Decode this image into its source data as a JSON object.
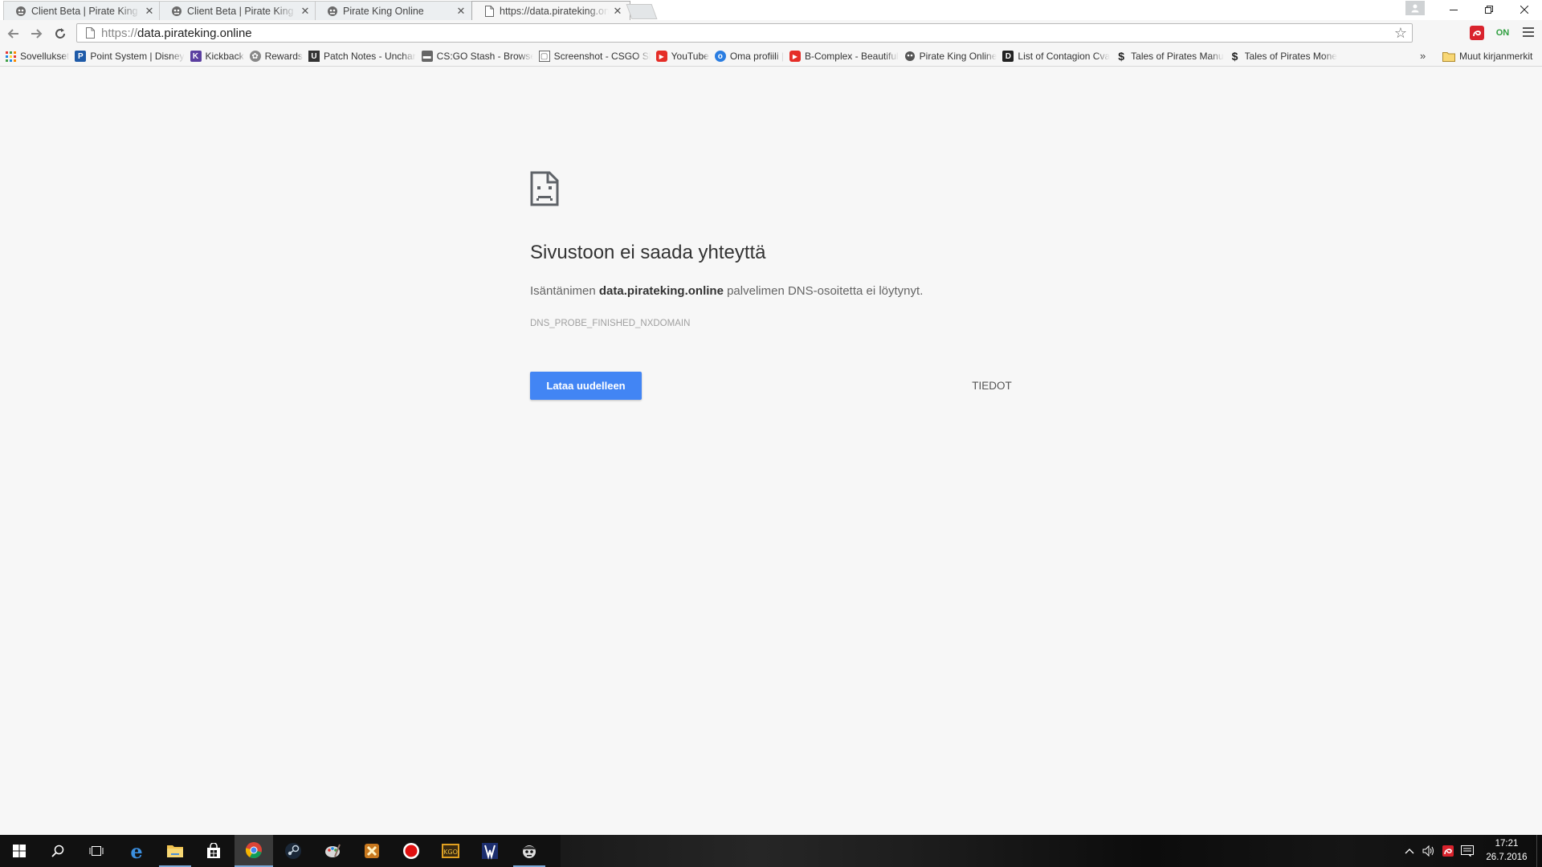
{
  "browser": {
    "tabs": [
      {
        "title": "Client Beta | Pirate King O",
        "icon": "pirate-icon",
        "active": false
      },
      {
        "title": "Client Beta | Pirate King O",
        "icon": "pirate-icon",
        "active": false
      },
      {
        "title": "Pirate King Online",
        "icon": "pirate-icon",
        "active": false
      },
      {
        "title": "https://data.pirateking.on",
        "icon": "page-icon",
        "active": true
      }
    ],
    "close_glyph": "✕",
    "omnibox": {
      "scheme": "https://",
      "host": "data.pirateking.online"
    },
    "bookmarks": [
      {
        "label": "Sovellukset",
        "icon": "apps-grid-icon",
        "color": "#e53935"
      },
      {
        "label": "Point System | Disney",
        "icon": "pd-icon",
        "color": "#1e5aa8"
      },
      {
        "label": "Kickback",
        "icon": "kickback-icon",
        "color": "#5b3fa0"
      },
      {
        "label": "Rewards",
        "icon": "rewards-icon",
        "color": "#777777"
      },
      {
        "label": "Patch Notes - Unchar",
        "icon": "uncharted-icon",
        "color": "#333333"
      },
      {
        "label": "CS:GO Stash - Browse",
        "icon": "csgo-icon",
        "color": "#555555"
      },
      {
        "label": "Screenshot - CSGO Sk",
        "icon": "screenshot-icon",
        "color": "#555555"
      },
      {
        "label": "YouTube",
        "icon": "youtube-icon",
        "color": "#e52d27"
      },
      {
        "label": "Oma profiili |",
        "icon": "profile-icon",
        "color": "#2a7de1"
      },
      {
        "label": "B-Complex - Beautiful",
        "icon": "youtube-icon",
        "color": "#e52d27"
      },
      {
        "label": "Pirate King Online",
        "icon": "pirate-icon",
        "color": "#555555"
      },
      {
        "label": "List of Contagion Cva",
        "icon": "contagion-icon",
        "color": "#222222"
      },
      {
        "label": "Tales of Pirates Manu",
        "icon": "dollar-icon",
        "color": "#222222"
      },
      {
        "label": "Tales of Pirates Mone",
        "icon": "dollar-icon",
        "color": "#222222"
      }
    ],
    "bookmarks_overflow": "»",
    "other_bookmarks": "Muut kirjanmerkit"
  },
  "error_page": {
    "heading": "Sivustoon ei saada yhteyttä",
    "desc_prefix": "Isäntänimen ",
    "desc_host": "data.pirateking.online",
    "desc_suffix": " palvelimen DNS-osoitetta ei löytynyt.",
    "error_code": "DNS_PROBE_FINISHED_NXDOMAIN",
    "reload_label": "Lataa uudelleen",
    "details_label": "TIEDOT",
    "accent_color": "#4285f4"
  },
  "taskbar": {
    "apps": [
      {
        "name": "search-icon"
      },
      {
        "name": "task-view-icon"
      },
      {
        "name": "edge-icon"
      },
      {
        "name": "file-explorer-icon"
      },
      {
        "name": "store-icon"
      },
      {
        "name": "chrome-icon"
      },
      {
        "name": "steam-icon"
      },
      {
        "name": "paint-icon"
      },
      {
        "name": "game-icon"
      },
      {
        "name": "record-icon"
      },
      {
        "name": "kgo-icon"
      },
      {
        "name": "game2-icon"
      },
      {
        "name": "pirate-king-icon"
      }
    ],
    "clock_time": "17:21",
    "clock_date": "26.7.2016"
  }
}
